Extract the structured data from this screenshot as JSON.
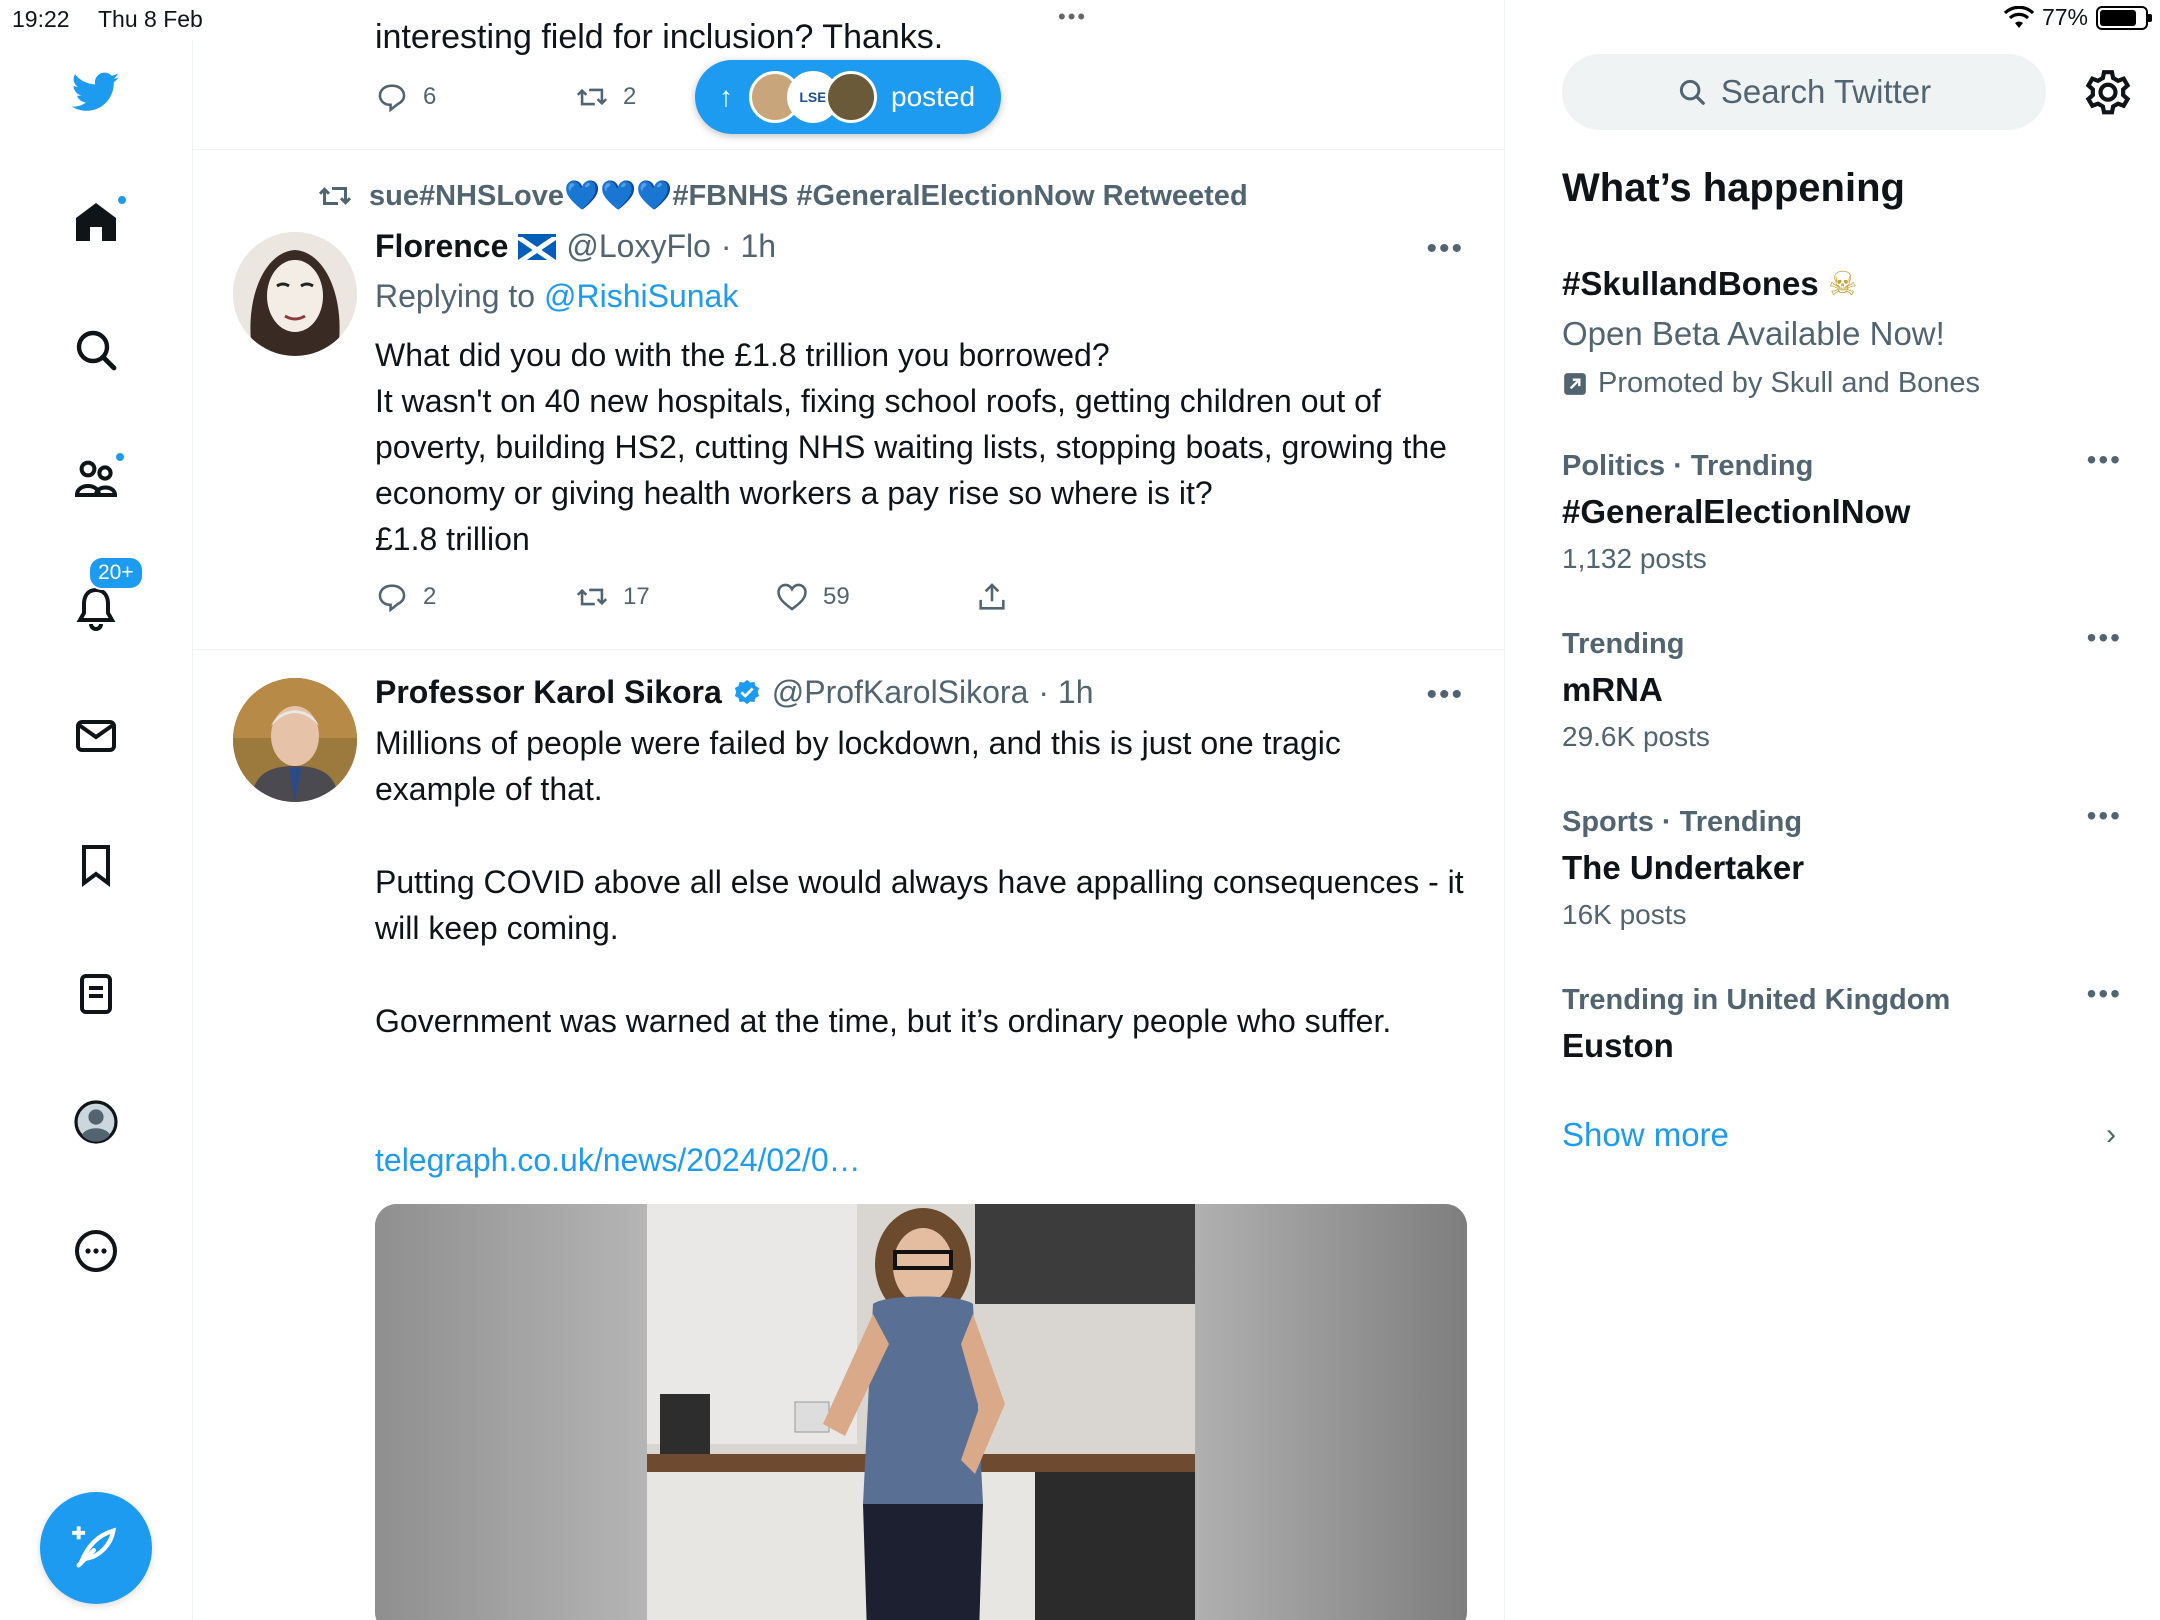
{
  "status_bar": {
    "time": "19:22",
    "date": "Thu 8 Feb",
    "battery": "77%"
  },
  "nav": {
    "notifications_badge": "20+"
  },
  "top_tweet": {
    "partial_text": "interesting field for inclusion? Thanks.",
    "replies": "6",
    "retweets": "2"
  },
  "posted_pill": {
    "label": "posted",
    "avatar_text": "LSE"
  },
  "tweet1": {
    "retweeted_by": "sue#NHSLove💙💙💙#FBNHS #GeneralElectionNow Retweeted",
    "name": "Florence",
    "flag": "🏴",
    "handle": "@LoxyFlo",
    "time": "· 1h",
    "replying_prefix": "Replying to",
    "replying_to": "@RishiSunak",
    "text": "What did you do with the £1.8 trillion you borrowed?\nIt wasn't on 40 new hospitals, fixing school roofs, getting children out of poverty, building HS2, cutting NHS waiting lists, stopping boats, growing the economy or giving health workers a pay rise so where is it?\n£1.8 trillion",
    "replies": "2",
    "retweets": "17",
    "likes": "59"
  },
  "tweet2": {
    "name": "Professor Karol Sikora",
    "handle": "@ProfKarolSikora",
    "time": "· 1h",
    "para1": "Millions of people were failed by lockdown, and this is just one tragic example of that.",
    "para2": "Putting COVID above all else would always have appalling consequences - it will keep coming.",
    "para3": "Government was warned at the time, but it’s ordinary people who suffer.",
    "link": "telegraph.co.uk/news/2024/02/0…"
  },
  "sidebar": {
    "search_placeholder": "Search Twitter",
    "title": "What’s happening",
    "promoted": {
      "name": "#SkullandBones",
      "emoji": "☠",
      "subtitle": "Open Beta Available Now!",
      "by": "Promoted by Skull and Bones"
    },
    "trends": [
      {
        "meta": "Politics · Trending",
        "name": "#GeneralElectionlNow",
        "count": "1,132 posts"
      },
      {
        "meta": "Trending",
        "name": "mRNA",
        "count": "29.6K posts"
      },
      {
        "meta": "Sports · Trending",
        "name": "The Undertaker",
        "count": "16K posts"
      },
      {
        "meta": "Trending in United Kingdom",
        "name": "Euston",
        "count": ""
      }
    ],
    "show_more": "Show more"
  },
  "colors": {
    "accent": "#1d9bf0",
    "text": "#0f1419",
    "secondary": "#536471"
  }
}
